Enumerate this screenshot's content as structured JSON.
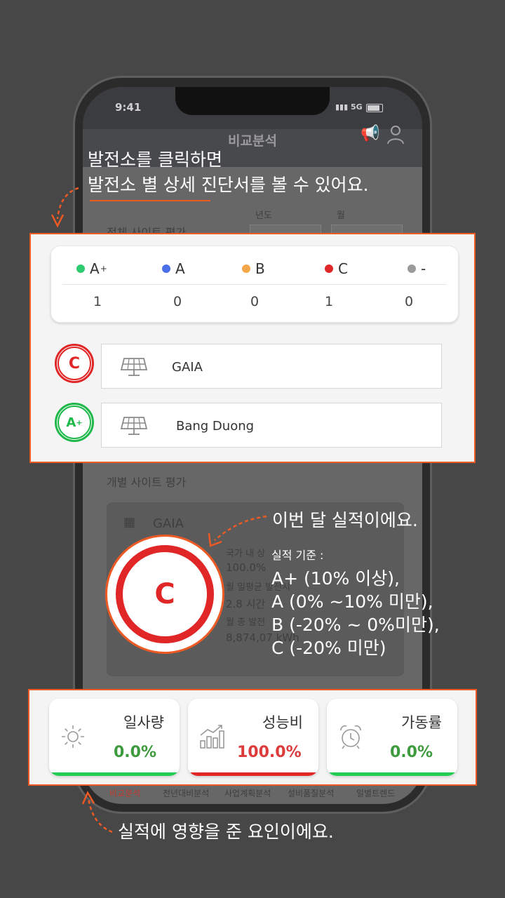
{
  "status": {
    "time": "9:41",
    "network": "5G"
  },
  "app": {
    "title": "비교분석"
  },
  "background": {
    "overall_label": "전체 사이트 평가",
    "year_label": "년도",
    "month_label": "월",
    "individual_label": "개별 사이트 평가",
    "site_name": "GAIA",
    "stats": [
      "국가 내 상",
      "100.0%",
      "월 일평균 발전시",
      "2.8 시간",
      "월 총 발전",
      "8,874,07 kWh"
    ]
  },
  "callouts": {
    "click_line1": "발전소를 클릭하면",
    "click_line2": "발전소 별 상세 진단서를 볼 수 있어요.",
    "month_perf": "이번 달 실적이에요.",
    "criteria_title": "실적 기준 :",
    "criteria": [
      "A+ (10% 이상),",
      "A (0% ~10% 미만),",
      "B (-20% ~ 0%미만),",
      "C (-20% 미만)"
    ],
    "factors": "실적에 영향을 준 요인이에요."
  },
  "grades": [
    {
      "label": "A",
      "sup": "+",
      "color": "#2ecc71",
      "count": "1"
    },
    {
      "label": "A",
      "sup": "",
      "color": "#4a6fe8",
      "count": "0"
    },
    {
      "label": "B",
      "sup": "",
      "color": "#f4a64a",
      "count": "0"
    },
    {
      "label": "C",
      "sup": "",
      "color": "#e02626",
      "count": "1"
    },
    {
      "label": "-",
      "sup": "",
      "color": "#9a9a9a",
      "count": "0"
    }
  ],
  "sites": [
    {
      "grade": "C",
      "name": "GAIA"
    },
    {
      "grade": "A",
      "grade_sup": "+",
      "name": "Bang Duong"
    }
  ],
  "big_grade": "C",
  "metrics": [
    {
      "label": "일사량",
      "value": "0.0%",
      "color": "#3d9a3d",
      "bar": "#22cc55",
      "icon": "sun-icon"
    },
    {
      "label": "성능비",
      "value": "100.0%",
      "color": "#dd3b3b",
      "bar": "#e02626",
      "icon": "bar-chart-icon"
    },
    {
      "label": "가동률",
      "value": "0.0%",
      "color": "#3d9a3d",
      "bar": "#22cc55",
      "icon": "alarm-clock-icon"
    }
  ],
  "tabs": [
    "비교분석",
    "전년대비분석",
    "사업계획분석",
    "설비품질분석",
    "일별트렌드"
  ]
}
